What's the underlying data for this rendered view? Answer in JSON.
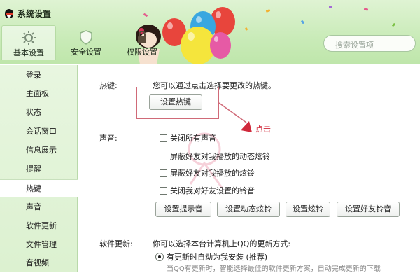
{
  "window": {
    "title": "系统设置"
  },
  "toolbar": {
    "tabs": [
      {
        "label": "基本设置",
        "icon": "gear-icon"
      },
      {
        "label": "安全设置",
        "icon": "shield-icon"
      },
      {
        "label": "权限设置",
        "icon": "lock-icon"
      }
    ],
    "search_placeholder": "搜索设置项"
  },
  "sidebar": {
    "items": [
      {
        "label": "登录"
      },
      {
        "label": "主面板"
      },
      {
        "label": "状态"
      },
      {
        "label": "会话窗口"
      },
      {
        "label": "信息展示"
      },
      {
        "label": "提醒"
      },
      {
        "label": "热键"
      },
      {
        "label": "声音"
      },
      {
        "label": "软件更新"
      },
      {
        "label": "文件管理"
      },
      {
        "label": "音视频"
      }
    ],
    "active_index": 6
  },
  "hotkey": {
    "label": "热键:",
    "description": "您可以通过点击选择要更改的热键。",
    "button": "设置热键"
  },
  "sound": {
    "label": "声音:",
    "options": [
      "关闭所有声音",
      "屏蔽好友对我播放的动态炫铃",
      "屏蔽好友对我播放的炫铃",
      "关闭我对好友设置的铃音"
    ],
    "buttons": [
      "设置提示音",
      "设置动态炫铃",
      "设置炫铃",
      "设置好友铃音"
    ]
  },
  "update": {
    "label": "软件更新:",
    "description": "你可以选择本台计算机上QQ的更新方式:",
    "option": "有更新时自动为我安装 (推荐)",
    "subnote": "当QQ有更新时，智能选择最佳的软件更新方案，自动完成更新的下载"
  },
  "annotation": {
    "callout": "点击"
  },
  "colors": {
    "header_green": "#c9ebb8",
    "sidebar_green": "#e2f3d8",
    "annotation_red": "#d0293b"
  }
}
